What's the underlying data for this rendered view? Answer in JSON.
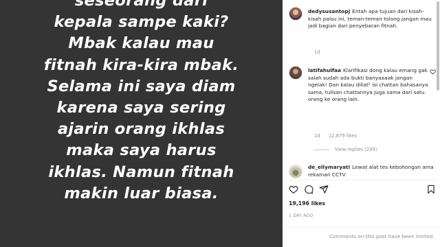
{
  "story": {
    "lines": [
      "seseorang dari",
      "kepala sampe kaki?",
      "Mbak kalau mau",
      "fitnah kira-kira mbak.",
      "Selama ini saya diam",
      "karena saya sering",
      "ajarin orang ikhlas",
      "maka saya harus",
      "ikhlas. Namun fitnah",
      "makin luar biasa."
    ]
  },
  "caption": {
    "username": "dedysusantopj",
    "text": "Entah apa tujuan dari kisah-kisah palsu ini, teman-teman tolong jangan mau jadi bagian dari penyebaran fitnah.",
    "time": "1d"
  },
  "comments": [
    {
      "username": "latifahulfaa",
      "text": "Klarifikasi dong kalau emang gak salah sudah ada bukti banyaaaak jangan ngelak! Dan kalau diliat² isi chattan bahasanya sama, tulisan chattannya juga sama dari satu orang ke orang lain.",
      "time": "1d",
      "likes": "12,879 likes",
      "view_replies": "View replies (209)"
    },
    {
      "username": "de_ellymaryati",
      "text": "Lewat alat tes kebohongan ama rekaman CCTV"
    }
  ],
  "post": {
    "likes": "19,196 likes",
    "date": "1 DAY AGO",
    "limited_message": "Comments on this post have been limited."
  },
  "icons": {
    "like": "heart-icon",
    "comment": "comment-icon",
    "share": "share-icon",
    "save": "bookmark-icon"
  }
}
